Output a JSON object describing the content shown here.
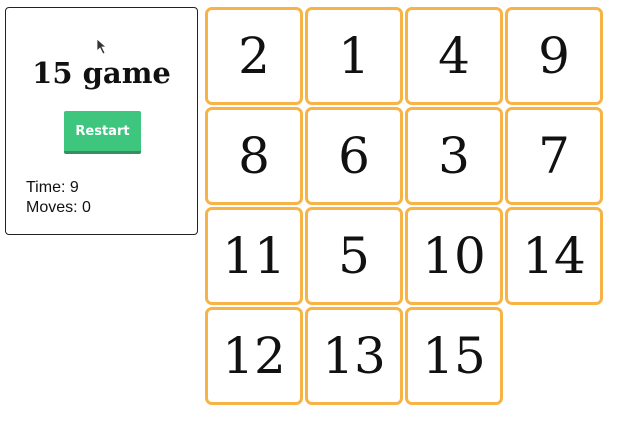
{
  "panel": {
    "title": "15 game",
    "restart_label": "Restart",
    "time_label": "Time:",
    "time_value": "9",
    "moves_label": "Moves:",
    "moves_value": "0"
  },
  "board": {
    "size": 4,
    "tiles": [
      2,
      1,
      4,
      9,
      8,
      6,
      3,
      7,
      11,
      5,
      10,
      14,
      12,
      13,
      15,
      null
    ]
  },
  "colors": {
    "tile_border": "#f7b346",
    "restart_bg": "#3ec67f",
    "restart_shadow": "#3a8d62",
    "text": "#111111"
  }
}
